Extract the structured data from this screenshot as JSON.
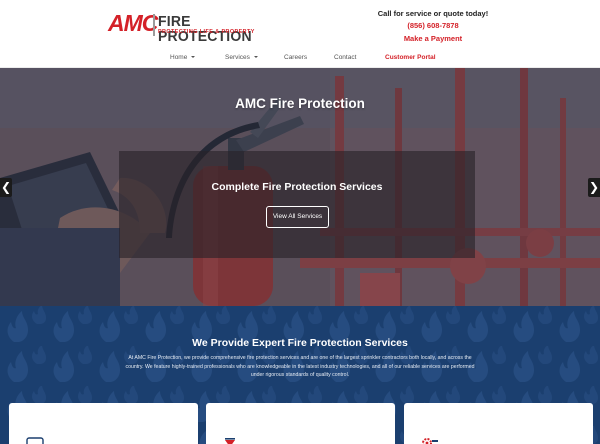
{
  "brand": {
    "logo_mark": "AMC",
    "logo_name": "FIRE PROTECTION",
    "logo_tagline": "PROTECTING LIFE & PROPERTY"
  },
  "contact": {
    "cta": "Call for service or quote today!",
    "phone": "(856) 608-7878",
    "payment_link": "Make a Payment"
  },
  "nav": {
    "items": [
      {
        "label": "Home",
        "has_dropdown": true
      },
      {
        "label": "Services",
        "has_dropdown": true
      },
      {
        "label": "Careers",
        "has_dropdown": false
      },
      {
        "label": "Contact",
        "has_dropdown": false
      },
      {
        "label": "Customer Portal",
        "has_dropdown": false
      }
    ]
  },
  "hero": {
    "title": "AMC Fire Protection",
    "subtitle": "Complete Fire Protection Services",
    "button_label": "View All Services",
    "prev_arrow": "❮",
    "next_arrow": "❯"
  },
  "services": {
    "heading": "We Provide Expert Fire Protection Services",
    "intro": "At AMC Fire Protection, we provide comprehensive fire protection services and are one of the largest sprinkler contractors both locally, and across the country. We feature highly-trained professionals who are knowledgeable in the latest industry technologies, and all of our reliable services are performed under rigorous standards of quality control.",
    "cards": [
      {
        "icon": "document-icon"
      },
      {
        "icon": "fire-extinguisher-icon"
      },
      {
        "icon": "gear-wrench-icon"
      }
    ]
  },
  "colors": {
    "brand_red": "#d42128",
    "band_navy": "#1b3f6f",
    "text_dark": "#222222"
  }
}
